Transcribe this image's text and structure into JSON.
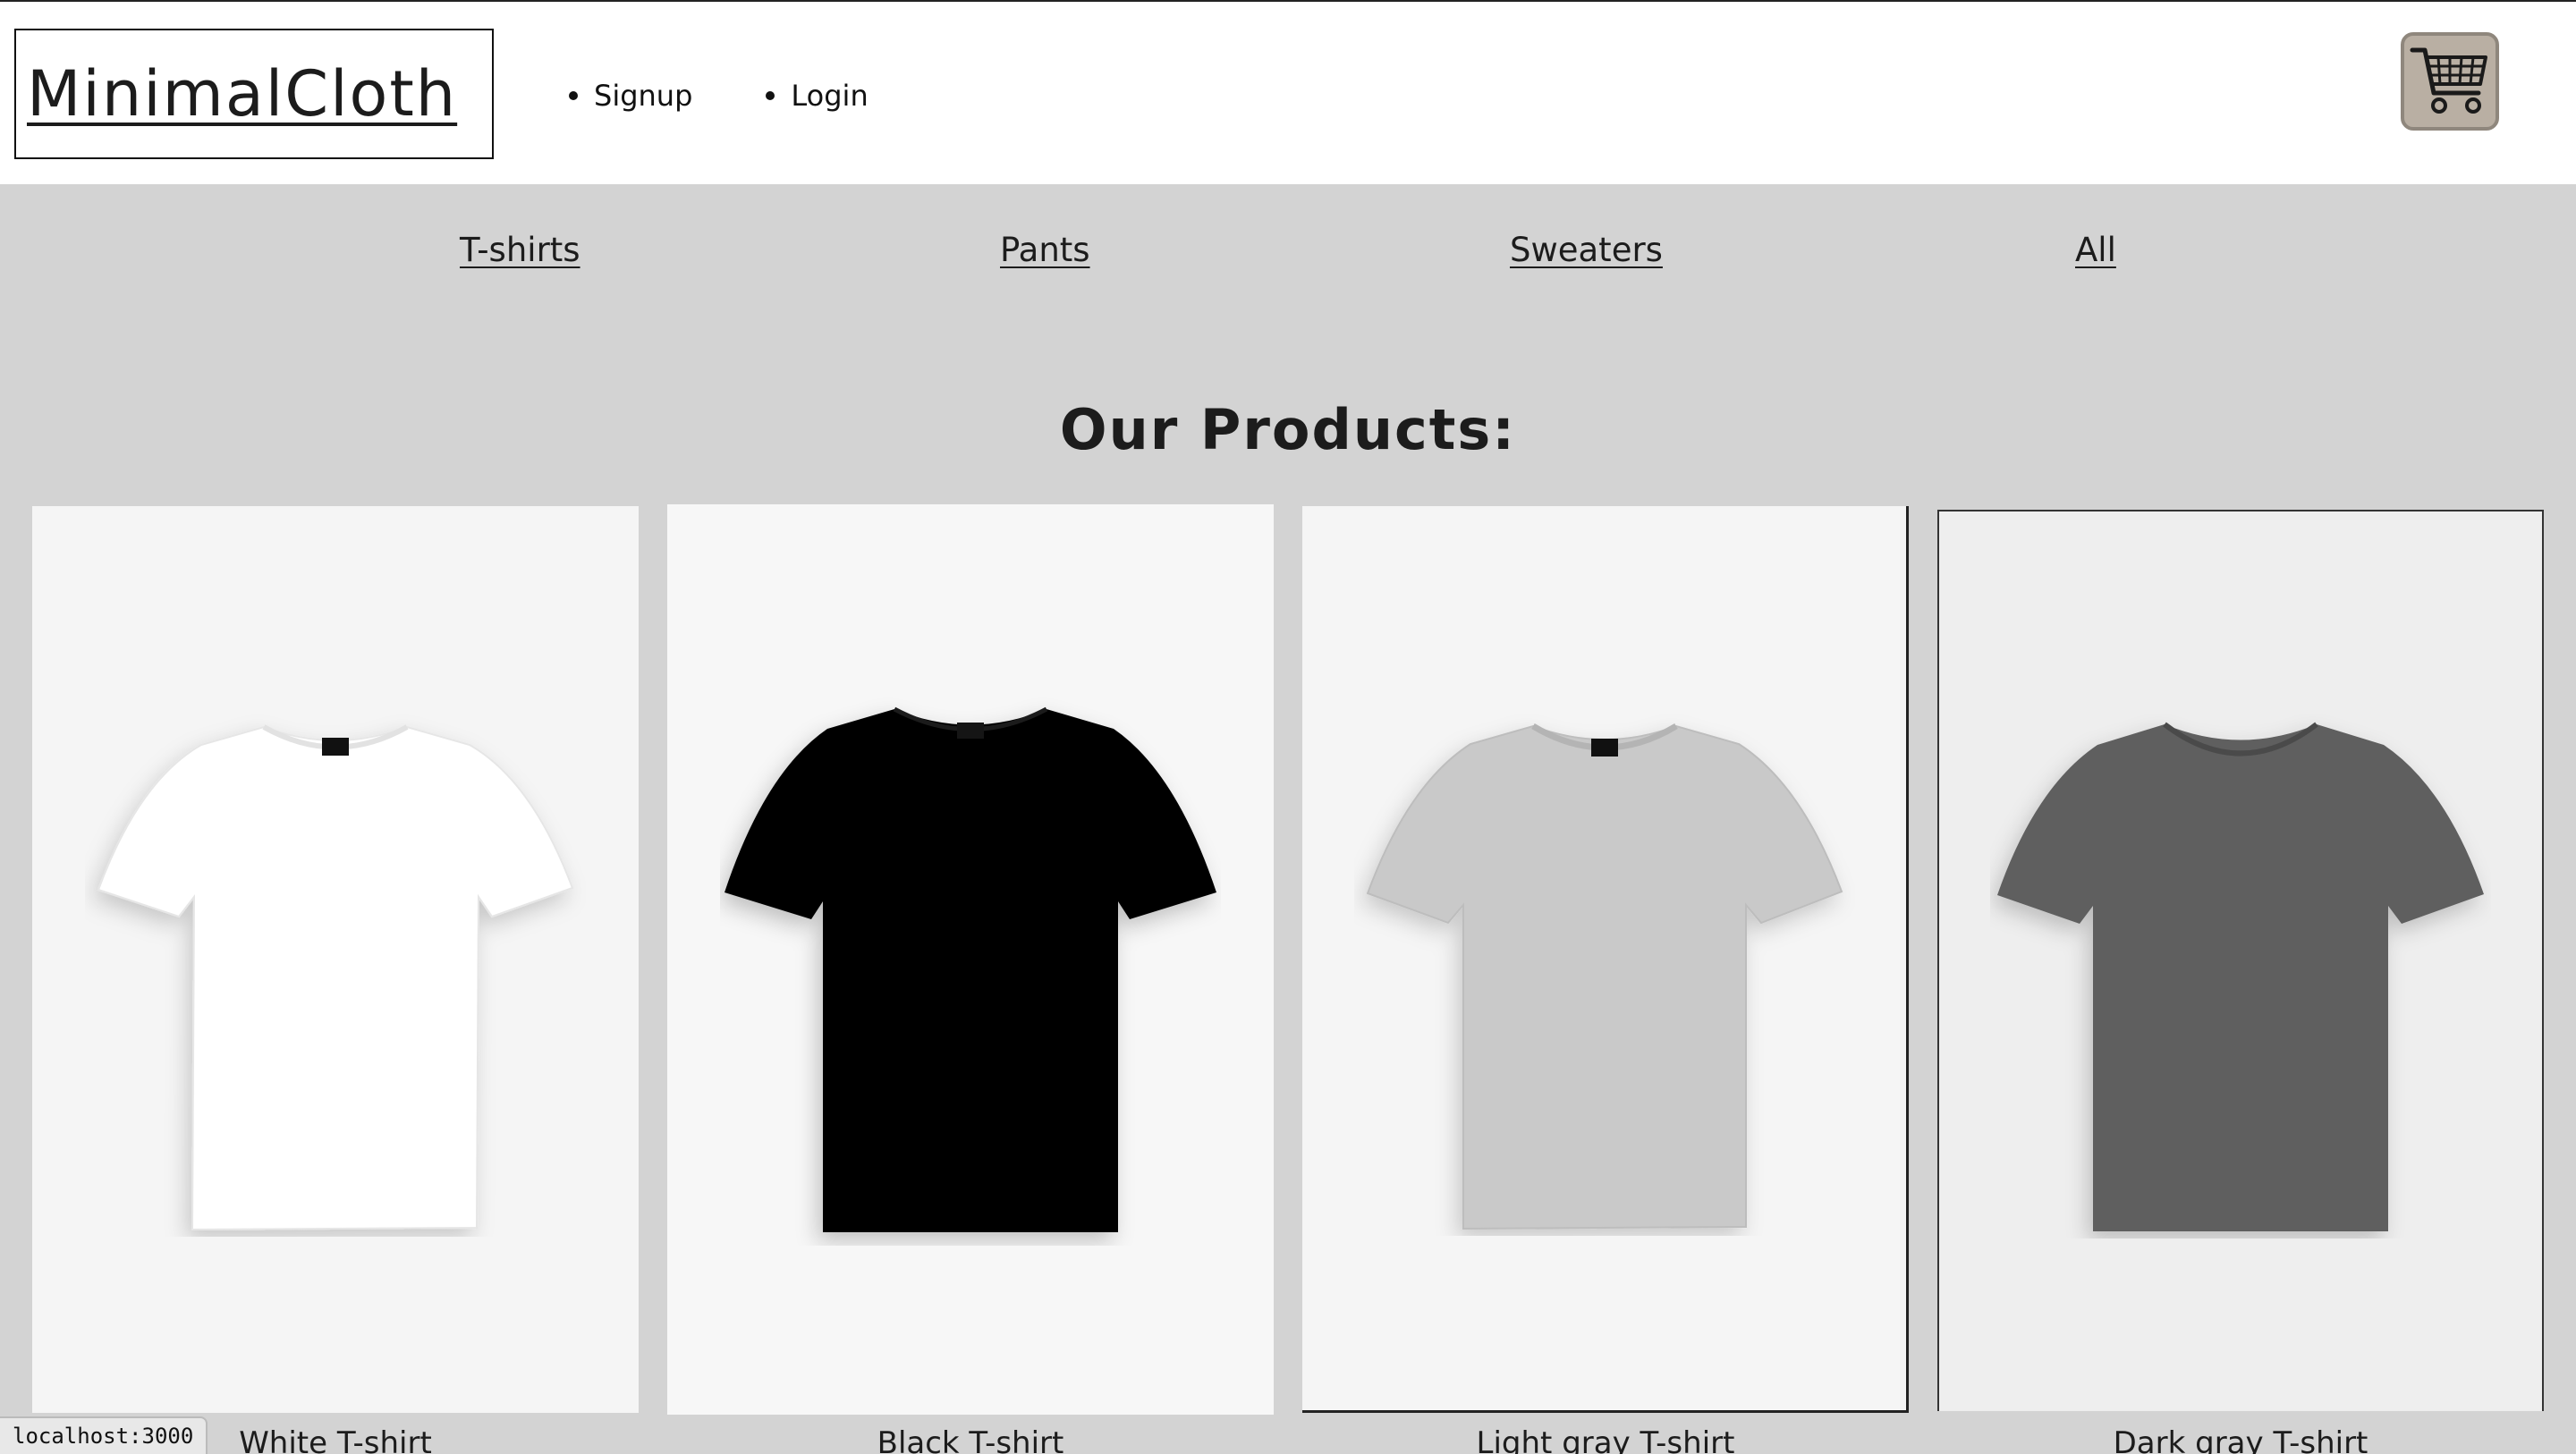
{
  "header": {
    "logo": "MinimalCloth",
    "auth_links": [
      "Signup",
      "Login"
    ],
    "cart_icon": "shopping-cart-icon"
  },
  "categories": [
    "T-shirts",
    "Pants",
    "Sweaters",
    "All"
  ],
  "section_title": "Our Products:",
  "products": [
    {
      "name": "White T-shirt",
      "color": "#ffffff"
    },
    {
      "name": "Black T-shirt",
      "color": "#0a0a0a"
    },
    {
      "name": "Light gray T-shirt",
      "color": "#c9c9c9"
    },
    {
      "name": "Dark gray T-shirt",
      "color": "#5e5e5e"
    }
  ],
  "status_bar": "localhost:3000",
  "colors": {
    "page_background": "#d3d3d3",
    "header_background": "#ffffff",
    "cart_button": "#b9afa3"
  }
}
